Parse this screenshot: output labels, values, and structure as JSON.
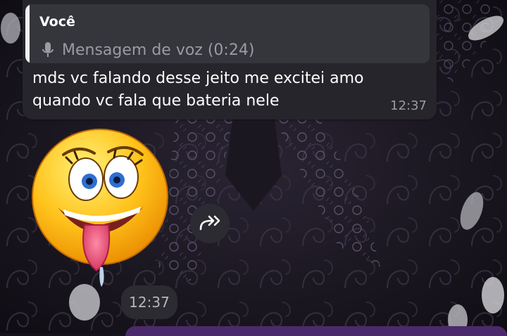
{
  "chat": {
    "reply": {
      "author": "Você",
      "quoted_text": "Mensagem de voz (0:24)",
      "icon": "mic-icon"
    },
    "message_text": "mds vc falando desse jeito me excitei amo quando vc fala que bateria nele",
    "message_time": "12:37",
    "sticker": {
      "icon": "excited-emoji-sticker"
    },
    "forward_icon": "forward-icon",
    "sticker_time": "12:37"
  },
  "colors": {
    "bubble": "#25252b",
    "quote_bg": "#35353c",
    "accent_outgoing": "#4b2a6b",
    "text_primary": "#ffffff",
    "text_secondary": "#9b9ba3"
  }
}
